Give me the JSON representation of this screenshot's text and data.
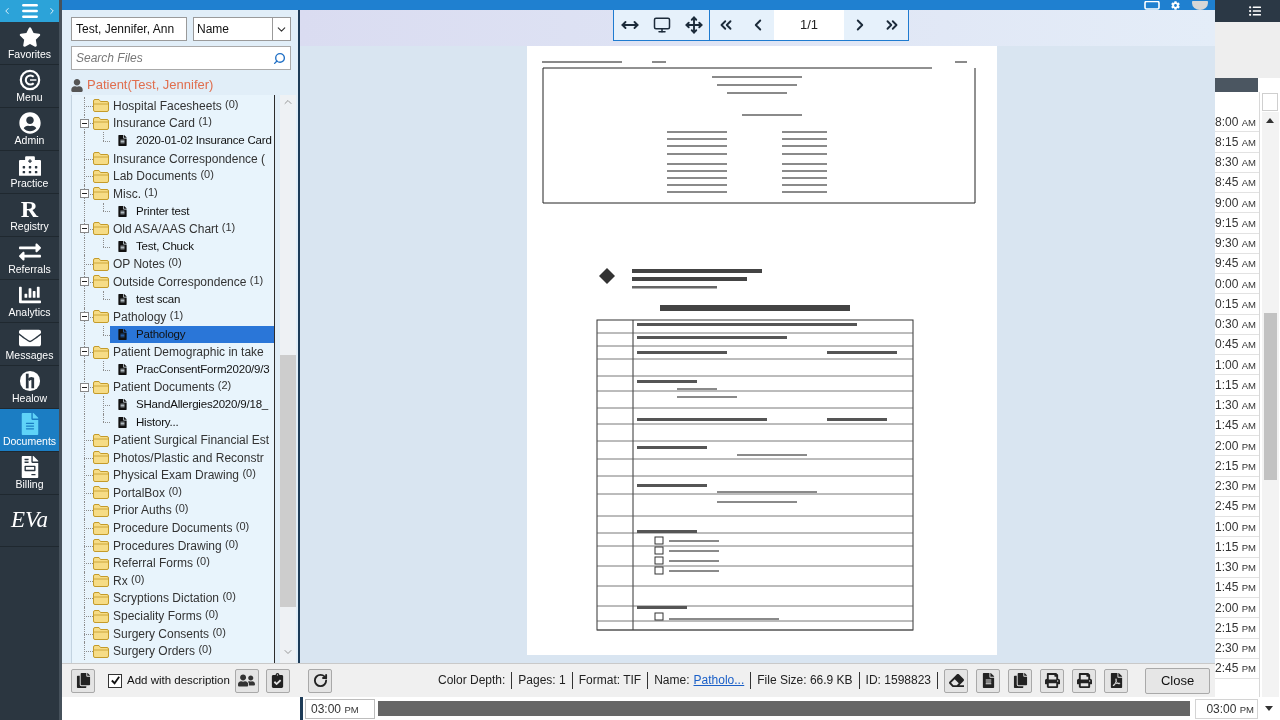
{
  "nav": {
    "items": [
      {
        "label": "Favorites",
        "selected": false
      },
      {
        "label": "Menu",
        "selected": false
      },
      {
        "label": "Admin",
        "selected": false
      },
      {
        "label": "Practice",
        "selected": false
      },
      {
        "label": "Registry",
        "glyph": "R",
        "selected": false
      },
      {
        "label": "Referrals",
        "selected": false
      },
      {
        "label": "Analytics",
        "selected": false
      },
      {
        "label": "Messages",
        "selected": false
      },
      {
        "label": "Healow",
        "selected": false
      },
      {
        "label": "Documents",
        "selected": true
      },
      {
        "label": "Billing",
        "selected": false
      }
    ],
    "brand": "EVa"
  },
  "patient_field": {
    "value": "Test, Jennifer, Ann"
  },
  "sort_field": {
    "value": "Name"
  },
  "search_field": {
    "placeholder": "Search Files"
  },
  "patient_header": "Patient(Test, Jennifer)",
  "tree": [
    {
      "label": "Hospital Facesheets",
      "count": "(0)",
      "expanded": false,
      "selected": false
    },
    {
      "label": "Insurance Card",
      "count": "(1)",
      "expanded": true,
      "selected": false,
      "children": [
        {
          "label": "2020-01-02 Insurance Card",
          "selected": false
        }
      ]
    },
    {
      "label": "Insurance Correspondence (",
      "expanded": false,
      "selected": false
    },
    {
      "label": "Lab Documents",
      "count": "(0)",
      "expanded": false,
      "selected": false
    },
    {
      "label": "Misc.",
      "count": "(1)",
      "expanded": true,
      "selected": false,
      "children": [
        {
          "label": "Printer test",
          "selected": false
        }
      ]
    },
    {
      "label": "Old ASA/AAS Chart",
      "count": "(1)",
      "expanded": true,
      "selected": false,
      "children": [
        {
          "label": "Test, Chuck",
          "selected": false
        }
      ]
    },
    {
      "label": "OP Notes",
      "count": "(0)",
      "expanded": false,
      "selected": false
    },
    {
      "label": "Outside Correspondence",
      "count": "(1)",
      "expanded": true,
      "selected": false,
      "children": [
        {
          "label": "test scan",
          "selected": false
        }
      ]
    },
    {
      "label": "Pathology",
      "count": "(1)",
      "expanded": true,
      "selected": false,
      "children": [
        {
          "label": "Pathology",
          "selected": true
        }
      ]
    },
    {
      "label": "Patient Demographic in take",
      "expanded": true,
      "selected": false,
      "children": [
        {
          "label": "PracConsentForm2020/9/3",
          "selected": false
        }
      ]
    },
    {
      "label": "Patient Documents",
      "count": "(2)",
      "expanded": true,
      "selected": false,
      "children": [
        {
          "label": "SHandAllergies2020/9/18_",
          "selected": false
        },
        {
          "label": "History...",
          "selected": false
        }
      ]
    },
    {
      "label": "Patient Surgical Financial Est",
      "expanded": false,
      "selected": false
    },
    {
      "label": "Photos/Plastic and Reconstr",
      "expanded": false,
      "selected": false
    },
    {
      "label": "Physical Exam Drawing",
      "count": "(0)",
      "expanded": false,
      "selected": false
    },
    {
      "label": "PortalBox",
      "count": "(0)",
      "expanded": false,
      "selected": false
    },
    {
      "label": "Prior Auths",
      "count": "(0)",
      "expanded": false,
      "selected": false
    },
    {
      "label": "Procedure Documents",
      "count": "(0)",
      "expanded": false,
      "selected": false
    },
    {
      "label": "Procedures Drawing",
      "count": "(0)",
      "expanded": false,
      "selected": false
    },
    {
      "label": "Referral Forms",
      "count": "(0)",
      "expanded": false,
      "selected": false
    },
    {
      "label": "Rx",
      "count": "(0)",
      "expanded": false,
      "selected": false
    },
    {
      "label": "Scryptions Dictation",
      "count": "(0)",
      "expanded": false,
      "selected": false
    },
    {
      "label": "Speciality Forms",
      "count": "(0)",
      "expanded": false,
      "selected": false
    },
    {
      "label": "Surgery Consents",
      "count": "(0)",
      "expanded": false,
      "selected": false
    },
    {
      "label": "Surgery Orders",
      "count": "(0)",
      "expanded": false,
      "selected": false
    }
  ],
  "viewer": {
    "page_indicator": "1/1"
  },
  "bottom_bar": {
    "add_with_description": {
      "label": "Add with description",
      "checked": true
    },
    "file_info": [
      {
        "kind": "text",
        "text": "Color Depth:"
      },
      {
        "kind": "text",
        "text": "Pages: 1"
      },
      {
        "kind": "text",
        "text": "Format: TIF"
      },
      {
        "kind": "link",
        "label": "Name:",
        "link": "Patholo..."
      },
      {
        "kind": "text",
        "text": "File Size: 66.9 KB"
      },
      {
        "kind": "text",
        "text": "ID: 1598823"
      }
    ],
    "close_button": "Close"
  },
  "schedule": {
    "times": [
      {
        "time": "8:00",
        "period": "AM"
      },
      {
        "time": "8:15",
        "period": "AM"
      },
      {
        "time": "8:30",
        "period": "AM"
      },
      {
        "time": "8:45",
        "period": "AM"
      },
      {
        "time": "9:00",
        "period": "AM"
      },
      {
        "time": "9:15",
        "period": "AM"
      },
      {
        "time": "9:30",
        "period": "AM"
      },
      {
        "time": "9:45",
        "period": "AM"
      },
      {
        "time": "0:00",
        "period": "AM"
      },
      {
        "time": "0:15",
        "period": "AM"
      },
      {
        "time": "0:30",
        "period": "AM"
      },
      {
        "time": "0:45",
        "period": "AM"
      },
      {
        "time": "1:00",
        "period": "AM"
      },
      {
        "time": "1:15",
        "period": "AM"
      },
      {
        "time": "1:30",
        "period": "AM"
      },
      {
        "time": "1:45",
        "period": "AM"
      },
      {
        "time": "2:00",
        "period": "PM"
      },
      {
        "time": "2:15",
        "period": "PM"
      },
      {
        "time": "2:30",
        "period": "PM"
      },
      {
        "time": "2:45",
        "period": "PM"
      },
      {
        "time": "1:00",
        "period": "PM"
      },
      {
        "time": "1:15",
        "period": "PM"
      },
      {
        "time": "1:30",
        "period": "PM"
      },
      {
        "time": "1:45",
        "period": "PM"
      },
      {
        "time": "2:00",
        "period": "PM"
      },
      {
        "time": "2:15",
        "period": "PM"
      },
      {
        "time": "2:30",
        "period": "PM"
      },
      {
        "time": "2:45",
        "period": "PM"
      }
    ],
    "footer": [
      {
        "time": "03:00",
        "period": "PM"
      },
      {
        "time": "03:00",
        "period": "PM"
      }
    ]
  }
}
